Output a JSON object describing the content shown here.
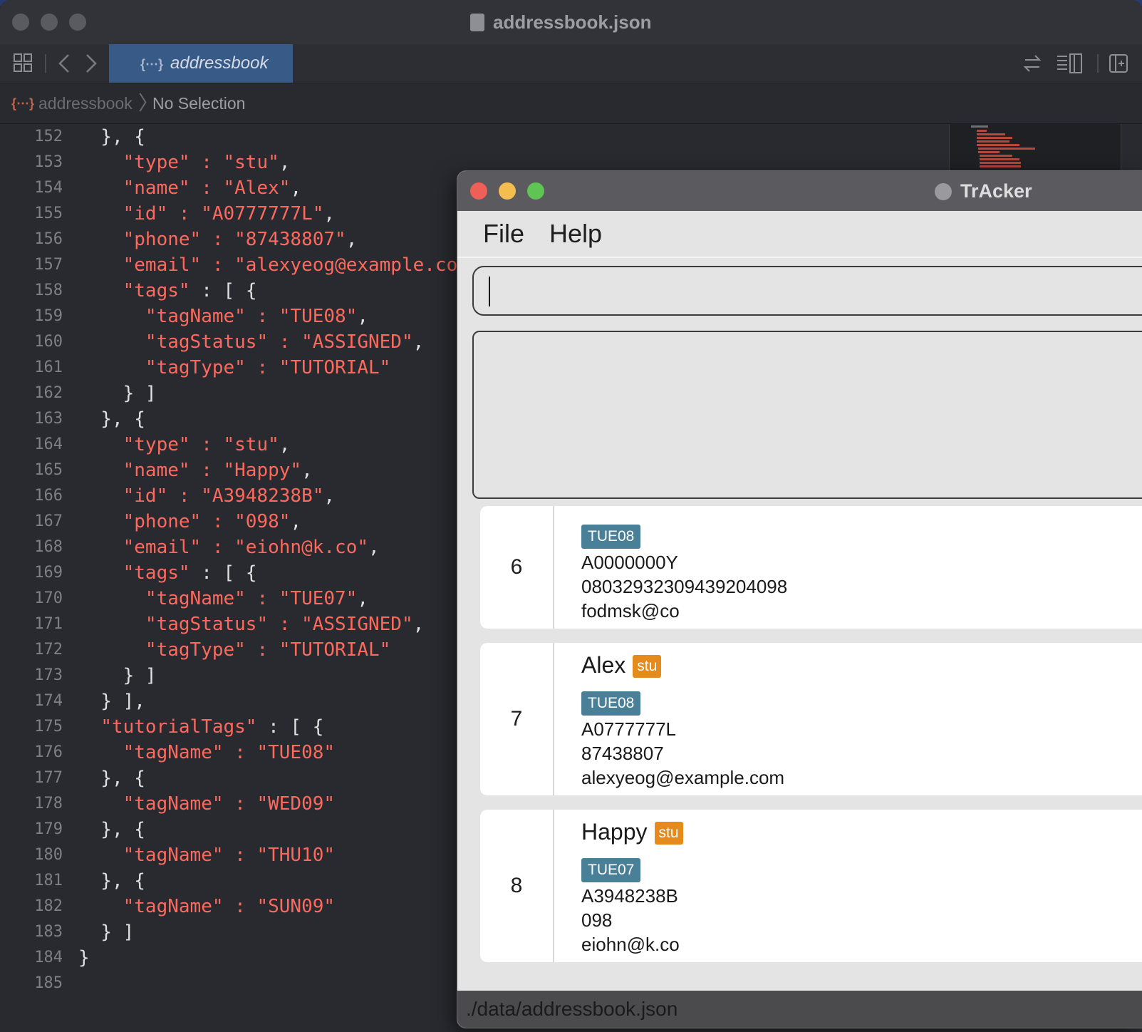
{
  "xcode": {
    "title": "addressbook.json",
    "tab_label": "addressbook",
    "tab_icon": "{⋯}",
    "breadcrumb_file": "addressbook",
    "breadcrumb_selection": "No Selection",
    "line_numbers": [
      "152",
      "153",
      "154",
      "155",
      "156",
      "157",
      "158",
      "159",
      "160",
      "161",
      "162",
      "163",
      "164",
      "165",
      "166",
      "167",
      "168",
      "169",
      "170",
      "171",
      "172",
      "173",
      "174",
      "175",
      "176",
      "177",
      "178",
      "179",
      "180",
      "181",
      "182",
      "183",
      "184",
      "185"
    ],
    "code_lines": [
      {
        "pre": "  }, {",
        "str": "",
        "post": ""
      },
      {
        "pre": "    ",
        "str": "\"type\" : \"stu\"",
        "post": ","
      },
      {
        "pre": "    ",
        "str": "\"name\" : \"Alex\"",
        "post": ","
      },
      {
        "pre": "    ",
        "str": "\"id\" : \"A0777777L\"",
        "post": ","
      },
      {
        "pre": "    ",
        "str": "\"phone\" : \"87438807\"",
        "post": ","
      },
      {
        "pre": "    ",
        "str": "\"email\" : \"alexyeog@example.co",
        "post": ""
      },
      {
        "pre": "    ",
        "str": "\"tags\"",
        "post": " : [ {"
      },
      {
        "pre": "      ",
        "str": "\"tagName\" : \"TUE08\"",
        "post": ","
      },
      {
        "pre": "      ",
        "str": "\"tagStatus\" : \"ASSIGNED\"",
        "post": ","
      },
      {
        "pre": "      ",
        "str": "\"tagType\" : \"TUTORIAL\"",
        "post": ""
      },
      {
        "pre": "    } ]",
        "str": "",
        "post": ""
      },
      {
        "pre": "  }, {",
        "str": "",
        "post": ""
      },
      {
        "pre": "    ",
        "str": "\"type\" : \"stu\"",
        "post": ","
      },
      {
        "pre": "    ",
        "str": "\"name\" : \"Happy\"",
        "post": ","
      },
      {
        "pre": "    ",
        "str": "\"id\" : \"A3948238B\"",
        "post": ","
      },
      {
        "pre": "    ",
        "str": "\"phone\" : \"098\"",
        "post": ","
      },
      {
        "pre": "    ",
        "str": "\"email\" : \"eiohn@k.co\"",
        "post": ","
      },
      {
        "pre": "    ",
        "str": "\"tags\"",
        "post": " : [ {"
      },
      {
        "pre": "      ",
        "str": "\"tagName\" : \"TUE07\"",
        "post": ","
      },
      {
        "pre": "      ",
        "str": "\"tagStatus\" : \"ASSIGNED\"",
        "post": ","
      },
      {
        "pre": "      ",
        "str": "\"tagType\" : \"TUTORIAL\"",
        "post": ""
      },
      {
        "pre": "    } ]",
        "str": "",
        "post": ""
      },
      {
        "pre": "  } ],",
        "str": "",
        "post": ""
      },
      {
        "pre": "  ",
        "str": "\"tutorialTags\"",
        "post": " : [ {"
      },
      {
        "pre": "    ",
        "str": "\"tagName\" : \"TUE08\"",
        "post": ""
      },
      {
        "pre": "  }, {",
        "str": "",
        "post": ""
      },
      {
        "pre": "    ",
        "str": "\"tagName\" : \"WED09\"",
        "post": ""
      },
      {
        "pre": "  }, {",
        "str": "",
        "post": ""
      },
      {
        "pre": "    ",
        "str": "\"tagName\" : \"THU10\"",
        "post": ""
      },
      {
        "pre": "  }, {",
        "str": "",
        "post": ""
      },
      {
        "pre": "    ",
        "str": "\"tagName\" : \"SUN09\"",
        "post": ""
      },
      {
        "pre": "  } ]",
        "str": "",
        "post": ""
      },
      {
        "pre": "}",
        "str": "",
        "post": ""
      },
      {
        "pre": "",
        "str": "",
        "post": ""
      }
    ]
  },
  "tracker": {
    "title": "TrAcker",
    "menu": {
      "file": "File",
      "help": "Help"
    },
    "command_value": "",
    "status_path": "./data/addressbook.json",
    "persons": [
      {
        "index": "6",
        "name": "",
        "type": "",
        "tag": "TUE08",
        "id": "A0000000Y",
        "phone": "08032932309439204098",
        "email": "fodmsk@co"
      },
      {
        "index": "7",
        "name": "Alex",
        "type": "stu",
        "tag": "TUE08",
        "id": "A0777777L",
        "phone": "87438807",
        "email": "alexyeog@example.com"
      },
      {
        "index": "8",
        "name": "Happy",
        "type": "stu",
        "tag": "TUE07",
        "id": "A3948238B",
        "phone": "098",
        "email": "eiohn@k.co"
      }
    ]
  },
  "colors": {
    "json_string": "#fc6a5d",
    "tag_bg": "#4a7f98",
    "type_badge_bg": "#e58a1c",
    "close": "#ed5f57",
    "minimize": "#f4bd4f",
    "zoom": "#5fc453"
  }
}
